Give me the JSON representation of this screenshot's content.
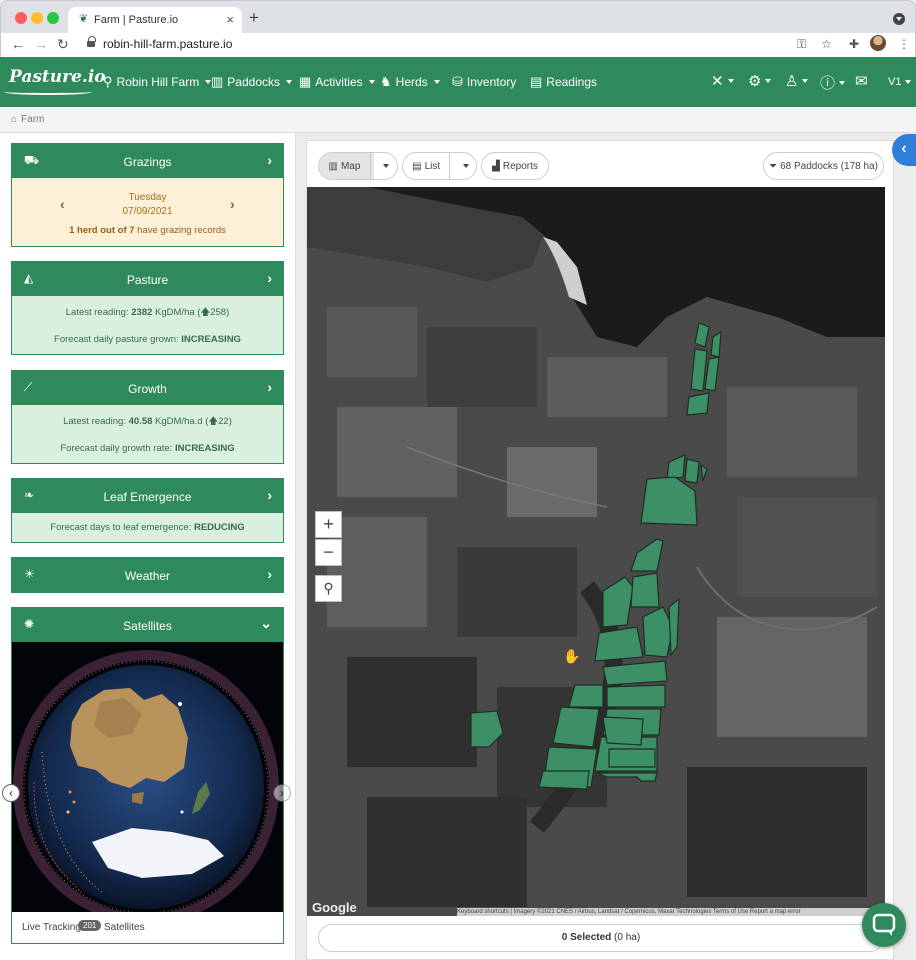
{
  "browser": {
    "tab_title": "Farm | Pasture.io",
    "url": "robin-hill-farm.pasture.io"
  },
  "navbar": {
    "logo": "Pasture.io",
    "items": [
      {
        "label": "Robin Hill Farm",
        "icon": "map-pin-icon"
      },
      {
        "label": "Paddocks",
        "icon": "map-icon"
      },
      {
        "label": "Activities",
        "icon": "calendar-icon"
      },
      {
        "label": "Herds",
        "icon": "cow-icon"
      },
      {
        "label": "Inventory",
        "icon": "boxes-icon"
      },
      {
        "label": "Readings",
        "icon": "table-icon"
      }
    ],
    "version": "V1"
  },
  "breadcrumb": {
    "home": "Farm"
  },
  "cards": {
    "grazings": {
      "title": "Grazings",
      "day": "Tuesday",
      "date": "07/09/2021",
      "summary_a": "1 herd out of 7",
      "summary_b": " have grazing records"
    },
    "pasture": {
      "title": "Pasture",
      "reading_prefix": "Latest reading: ",
      "reading_value": "2382",
      "reading_unit": " KgDM/ha (",
      "reading_change": "258",
      "forecast_prefix": "Forecast daily pasture grown: ",
      "forecast_value": "INCREASING"
    },
    "growth": {
      "title": "Growth",
      "reading_prefix": "Latest reading: ",
      "reading_value": "40.58",
      "reading_unit": " KgDM/ha.d (",
      "reading_change": "22",
      "forecast_prefix": "Forecast daily growth rate: ",
      "forecast_value": "INCREASING"
    },
    "leaf": {
      "title": "Leaf Emergence",
      "forecast_prefix": "Forecast days to leaf emergence: ",
      "forecast_value": "REDUCING"
    },
    "weather": {
      "title": "Weather"
    },
    "satellites": {
      "title": "Satellites",
      "footer_prefix": "Live Tracking",
      "count": "201",
      "footer_suffix": "Satellites"
    }
  },
  "map_toolbar": {
    "map_label": "Map",
    "list_label": "List",
    "reports_label": "Reports",
    "filter_label": "68 Paddocks (178 ha)"
  },
  "map": {
    "google_label": "Google",
    "attribution": "Keyboard shortcuts  |  Imagery ©2021 CNES / Airbus, Landsat / Copernicus, Maxar Technologies   Terms of Use   Report a map error"
  },
  "selection": {
    "count_label": "0 Selected",
    "area_label": " (0 ha)"
  },
  "colors": {
    "brand": "#2f8a5b",
    "paddock": "#3d8f66",
    "card_green": "#d8f0dd",
    "card_cream": "#fcf1d8",
    "accent_blue": "#2f7fd8"
  }
}
